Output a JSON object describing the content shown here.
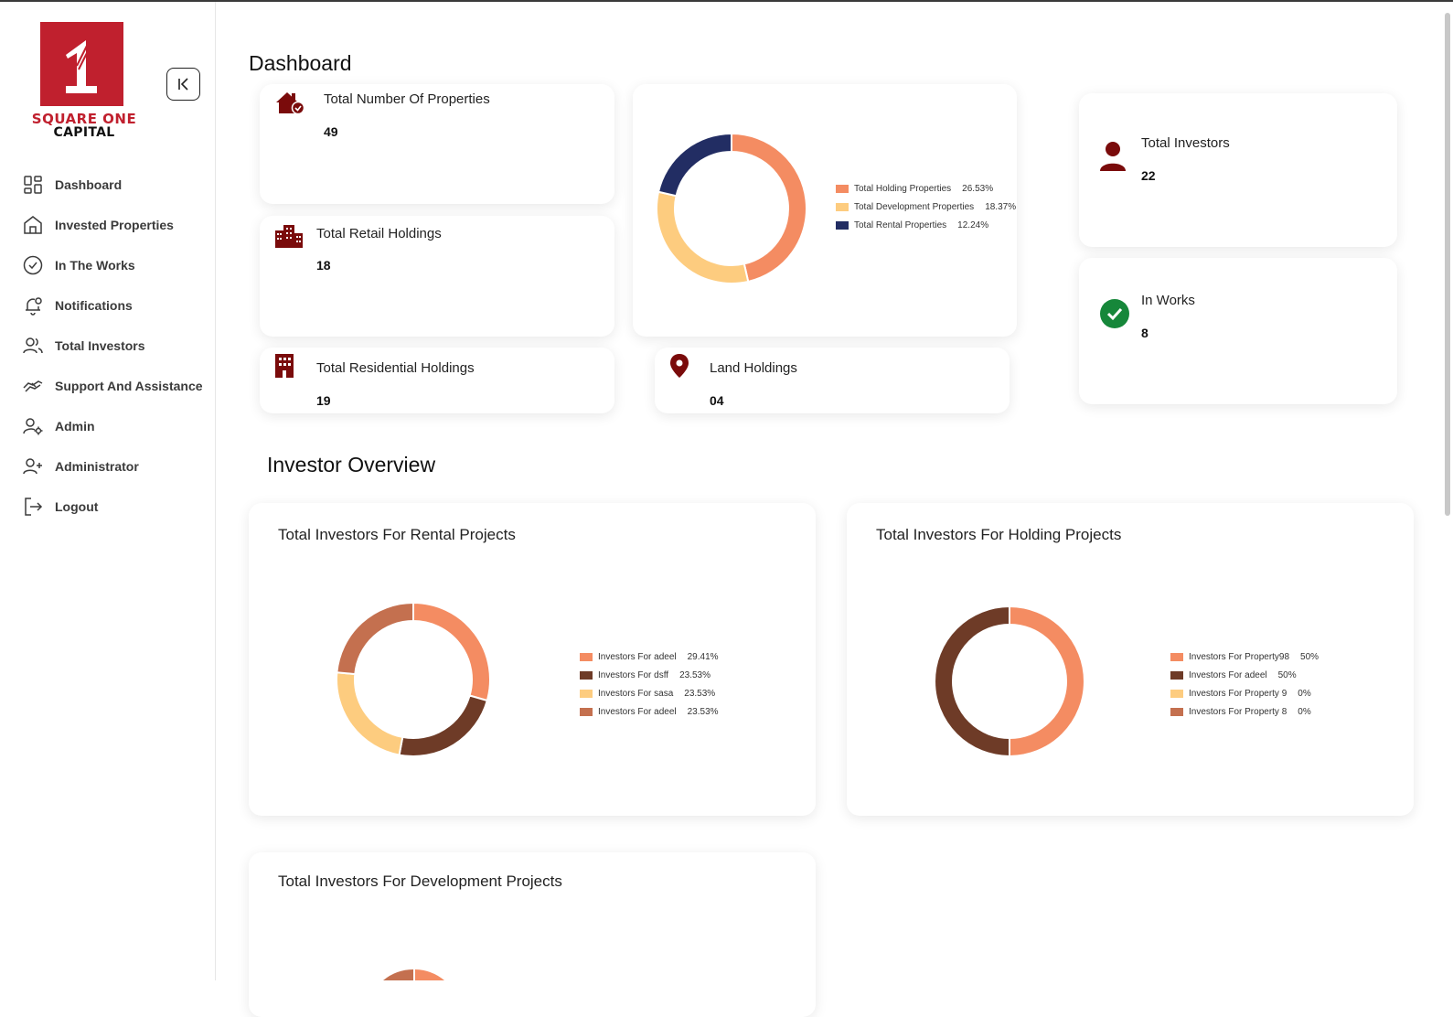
{
  "app": {
    "logo_sq": "SQUARE ONE",
    "logo_cap": "CAPITAL",
    "logo_numeral": "1"
  },
  "sidebar": {
    "items": [
      {
        "label": "Dashboard",
        "icon": "dashboard-icon"
      },
      {
        "label": "Invested Properties",
        "icon": "home-icon"
      },
      {
        "label": "In The Works",
        "icon": "check-circle-icon"
      },
      {
        "label": "Notifications",
        "icon": "bell-icon"
      },
      {
        "label": "Total Investors",
        "icon": "users-icon"
      },
      {
        "label": "Support And Assistance",
        "icon": "handshake-icon"
      },
      {
        "label": "Admin",
        "icon": "user-gear-icon"
      },
      {
        "label": "Administrator",
        "icon": "user-plus-icon"
      },
      {
        "label": "Logout",
        "icon": "logout-icon"
      }
    ]
  },
  "dashboard": {
    "title": "Dashboard",
    "stats": {
      "total_properties": {
        "label": "Total Number Of Properties",
        "value": "49"
      },
      "retail": {
        "label": "Total Retail Holdings",
        "value": "18"
      },
      "residential": {
        "label": "Total Residential Holdings",
        "value": "19"
      },
      "land": {
        "label": "Land Holdings",
        "value": "04"
      },
      "investors": {
        "label": "Total Investors",
        "value": "22"
      },
      "in_works": {
        "label": "In Works",
        "value": "8"
      }
    }
  },
  "investor_overview": {
    "title": "Investor Overview",
    "rental_title": "Total Investors For Rental Projects",
    "holding_title": "Total Investors For Holding Projects",
    "development_title": "Total Investors For Development Projects"
  },
  "colors": {
    "brand_red": "#c0202e",
    "icon_maroon": "#7a0b0b",
    "success_green": "#16873a",
    "salmon": "#f48c62",
    "sand": "#fdcc7f",
    "navy": "#222d63",
    "brown": "#6e3b27",
    "terracotta": "#c4704f"
  },
  "chart_data": [
    {
      "type": "pie",
      "categories": [
        "Total Holding Properties",
        "Total Development Properties",
        "Total Rental Properties"
      ],
      "values": [
        26.53,
        18.37,
        12.24
      ],
      "labels": [
        "26.53%",
        "18.37%",
        "12.24%"
      ],
      "colors": [
        "#f48c62",
        "#fdcc7f",
        "#222d63"
      ],
      "donut": true,
      "legend": "right"
    },
    {
      "type": "pie",
      "title": "Total Investors For Rental Projects",
      "categories": [
        "Investors For adeel",
        "Investors For dsff",
        "Investors For sasa",
        "Investors For adeel"
      ],
      "values": [
        29.41,
        23.53,
        23.53,
        23.53
      ],
      "labels": [
        "29.41%",
        "23.53%",
        "23.53%",
        "23.53%"
      ],
      "colors": [
        "#f48c62",
        "#6e3b27",
        "#fdcc7f",
        "#c4704f"
      ],
      "donut": true,
      "legend": "right"
    },
    {
      "type": "pie",
      "title": "Total Investors For Holding Projects",
      "categories": [
        "Investors For Property98",
        "Investors For adeel",
        "Investors For Property 9",
        "Investors For Property 8"
      ],
      "values": [
        50,
        50,
        0,
        0
      ],
      "labels": [
        "50%",
        "50%",
        "0%",
        "0%"
      ],
      "colors": [
        "#f48c62",
        "#6e3b27",
        "#fdcc7f",
        "#c4704f"
      ],
      "donut": true,
      "legend": "right"
    }
  ]
}
